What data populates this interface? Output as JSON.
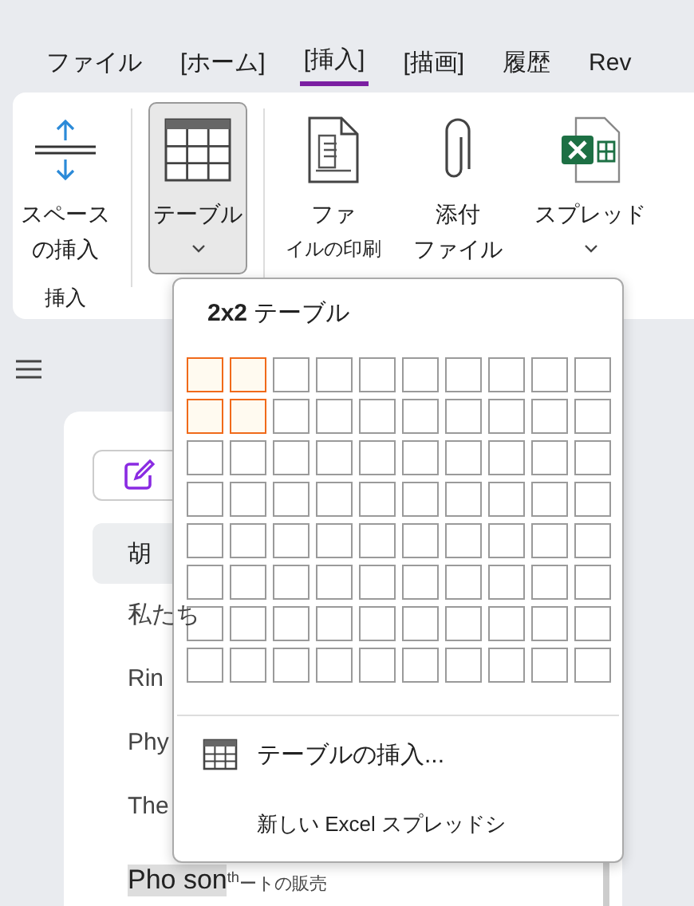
{
  "tabs": [
    {
      "label": "ファイル",
      "selected": false
    },
    {
      "label": "[ホーム]",
      "selected": false
    },
    {
      "label": "[挿入]",
      "selected": true
    },
    {
      "label": "[描画]",
      "selected": false
    },
    {
      "label": "履歴",
      "selected": false
    },
    {
      "label": "Rev",
      "selected": false
    }
  ],
  "ribbon": {
    "groups": [
      {
        "label": "挿入",
        "items": [
          {
            "kind": "space",
            "lines": [
              "スペース",
              "の挿入"
            ],
            "pressed": false,
            "dropdown": false
          }
        ]
      },
      {
        "items": [
          {
            "kind": "table",
            "lines": [
              "テーブル"
            ],
            "pressed": true,
            "dropdown": true
          }
        ]
      },
      {
        "items": [
          {
            "kind": "printout",
            "lines": [
              "ファ",
              "イルの印刷"
            ],
            "pressed": false,
            "dropdown": false
          },
          {
            "kind": "attach",
            "lines": [
              "添付",
              "ファイル"
            ],
            "pressed": false,
            "dropdown": false
          },
          {
            "kind": "spreadsheet",
            "lines": [
              "スプレッド"
            ],
            "pressed": false,
            "dropdown": true
          }
        ]
      }
    ]
  },
  "pages": [
    {
      "label": "胡",
      "selected": true
    },
    {
      "label": "私たち",
      "selected": false
    },
    {
      "label": "Rin",
      "selected": false
    },
    {
      "label": "Phy",
      "selected": false
    },
    {
      "label": "The",
      "selected": false
    }
  ],
  "highlighted_page": {
    "label": "Pho son",
    "suffix": "$^{th}$ートの販売"
  },
  "table_menu": {
    "title": "**2x2** テーブル",
    "grid": [
      [
        {
          "selected": true
        },
        {
          "selected": true
        },
        {
          "selected": false
        },
        {
          "selected": false
        },
        {
          "selected": false
        },
        {
          "selected": false
        },
        {
          "selected": false
        },
        {
          "selected": false
        },
        {
          "selected": false
        },
        {
          "selected": false
        }
      ],
      [
        {
          "selected": true
        },
        {
          "selected": true
        },
        {
          "selected": false
        },
        {
          "selected": false
        },
        {
          "selected": false
        },
        {
          "selected": false
        },
        {
          "selected": false
        },
        {
          "selected": false
        },
        {
          "selected": false
        },
        {
          "selected": false
        }
      ],
      [
        {
          "selected": false
        },
        {
          "selected": false
        },
        {
          "selected": false
        },
        {
          "selected": false
        },
        {
          "selected": false
        },
        {
          "selected": false
        },
        {
          "selected": false
        },
        {
          "selected": false
        },
        {
          "selected": false
        },
        {
          "selected": false
        }
      ],
      [
        {
          "selected": false
        },
        {
          "selected": false
        },
        {
          "selected": false
        },
        {
          "selected": false
        },
        {
          "selected": false
        },
        {
          "selected": false
        },
        {
          "selected": false
        },
        {
          "selected": false
        },
        {
          "selected": false
        },
        {
          "selected": false
        }
      ],
      [
        {
          "selected": false
        },
        {
          "selected": false
        },
        {
          "selected": false
        },
        {
          "selected": false
        },
        {
          "selected": false
        },
        {
          "selected": false
        },
        {
          "selected": false
        },
        {
          "selected": false
        },
        {
          "selected": false
        },
        {
          "selected": false
        }
      ],
      [
        {
          "selected": false
        },
        {
          "selected": false
        },
        {
          "selected": false
        },
        {
          "selected": false
        },
        {
          "selected": false
        },
        {
          "selected": false
        },
        {
          "selected": false
        },
        {
          "selected": false
        },
        {
          "selected": false
        },
        {
          "selected": false
        }
      ],
      [
        {
          "selected": false
        },
        {
          "selected": false
        },
        {
          "selected": false
        },
        {
          "selected": false
        },
        {
          "selected": false
        },
        {
          "selected": false
        },
        {
          "selected": false
        },
        {
          "selected": false
        },
        {
          "selected": false
        },
        {
          "selected": false
        }
      ],
      [
        {
          "selected": false
        },
        {
          "selected": false
        },
        {
          "selected": false
        },
        {
          "selected": false
        },
        {
          "selected": false
        },
        {
          "selected": false
        },
        {
          "selected": false
        },
        {
          "selected": false
        },
        {
          "selected": false
        },
        {
          "selected": false
        }
      ]
    ],
    "items": [
      {
        "kind": "insert",
        "label": "テーブルの挿入..."
      },
      {
        "kind": "excel",
        "label": "新しい Excel スプレッドシ"
      }
    ]
  }
}
